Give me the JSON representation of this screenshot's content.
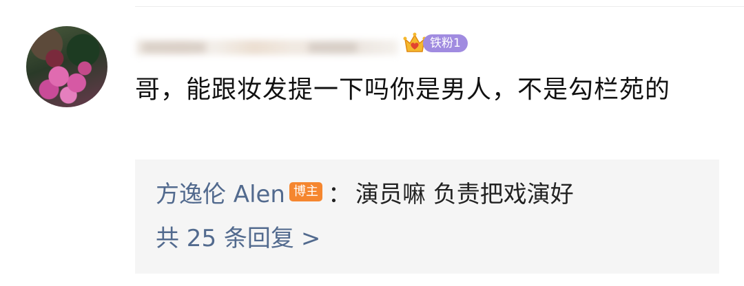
{
  "comment": {
    "username": "",
    "badge": {
      "icon": "crown-heart-icon",
      "label": "铁粉1",
      "color": "#a08be0"
    },
    "text": "哥，能跟妆发提一下吗你是男人，不是勾栏苑的"
  },
  "reply": {
    "author": "方逸伦 Alen",
    "author_tag": "博主",
    "separator": "：",
    "text": "演员嘛 负责把戏演好",
    "author_color": "#526a8e",
    "tag_color": "#f5862f"
  },
  "more_replies": {
    "label": "共 25 条回复",
    "chevron": ">"
  }
}
